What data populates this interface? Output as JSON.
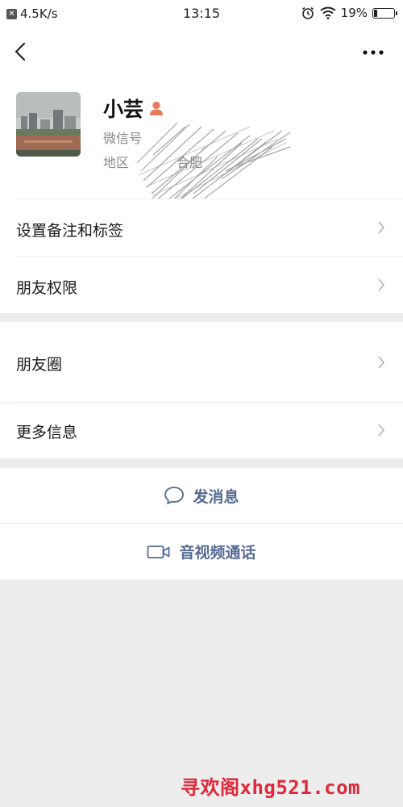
{
  "status_bar": {
    "network_speed": "4.5K/s",
    "time": "13:15",
    "battery_percent": "19%",
    "battery_level": 0.19
  },
  "header": {
    "back_icon": "back-chevron-icon",
    "more_icon": "more-dots-icon"
  },
  "profile": {
    "name": "小芸",
    "wechat_id_label": "微信号",
    "region_label": "地区",
    "region_value": "合肥",
    "gender_icon": "female-person-icon",
    "gender_color": "#e87a5d"
  },
  "menu": [
    {
      "label": "设置备注和标签"
    },
    {
      "label": "朋友权限"
    },
    {
      "label": "朋友圈"
    },
    {
      "label": "更多信息"
    }
  ],
  "actions": {
    "message": "发消息",
    "call": "音视频通话",
    "accent_color": "#576b95"
  },
  "watermark": "寻欢阁xhg521.com"
}
